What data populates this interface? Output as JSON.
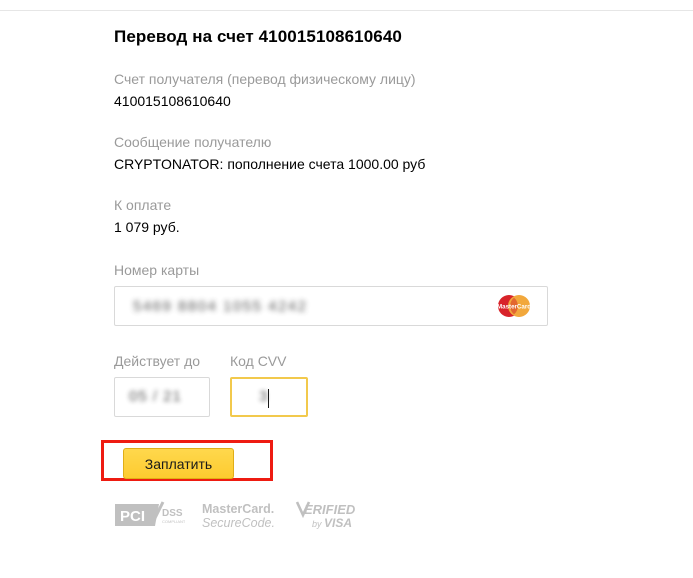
{
  "page": {
    "title": "Перевод на счет 410015108610640"
  },
  "fields": {
    "recipient_account": {
      "label": "Счет получателя (перевод физическому лицу)",
      "value": "410015108610640"
    },
    "message": {
      "label": "Сообщение получателю",
      "value": "CRYPTONATOR: пополнение счета 1000.00 руб"
    },
    "amount_due": {
      "label": "К оплате",
      "value": "1 079 руб."
    },
    "card_number": {
      "label": "Номер карты",
      "value": "5469 8804 1055 4242",
      "brand_icon": "mastercard-icon"
    },
    "expiry": {
      "label": "Действует до",
      "value": "05 / 21"
    },
    "cvv": {
      "label": "Код CVV",
      "value": "3",
      "focused": true
    }
  },
  "actions": {
    "pay_button_label": "Заплатить",
    "highlight_color": "#ee1b11"
  },
  "badges": [
    {
      "name": "pci-dss-badge",
      "primary": "PCI",
      "secondary": "DSS",
      "tertiary": "COMPLIANT"
    },
    {
      "name": "mastercard-securecode-badge",
      "primary": "MasterCard.",
      "secondary": "SecureCode."
    },
    {
      "name": "verified-by-visa-badge",
      "primary": "ERIFIED",
      "secondary": "by",
      "tertiary": "VISA"
    }
  ],
  "colors": {
    "label_gray": "#9a9a9a",
    "button_yellow": "#fdcb2f",
    "focus_border": "#f2c94c",
    "mastercard_red": "#d8232a",
    "mastercard_orange": "#f2a83c"
  }
}
